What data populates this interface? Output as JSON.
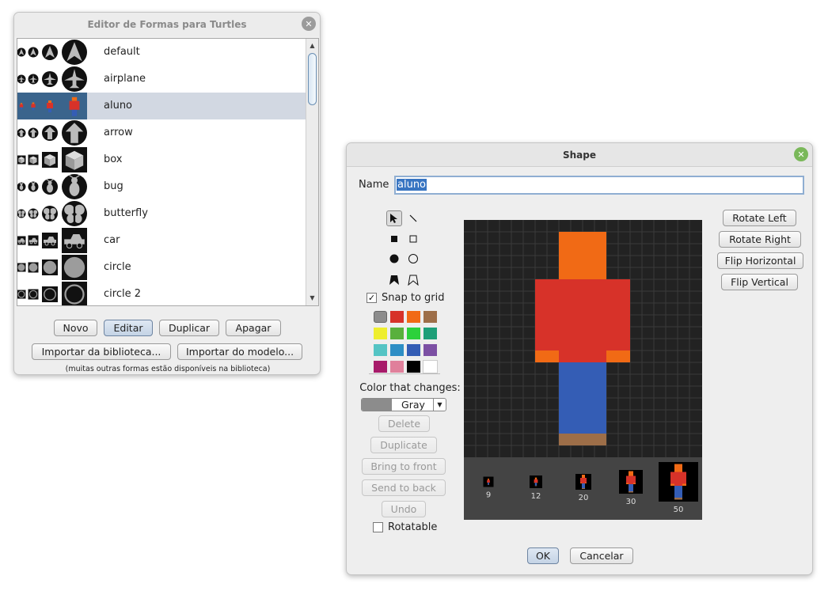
{
  "shapes_editor": {
    "title": "Editor de Formas para Turtles",
    "close_icon": "x-icon",
    "shapes": [
      {
        "name": "default",
        "icon": "arrowhead-icon"
      },
      {
        "name": "airplane",
        "icon": "airplane-icon"
      },
      {
        "name": "aluno",
        "icon": "person-icon",
        "selected": true
      },
      {
        "name": "arrow",
        "icon": "up-arrow-icon"
      },
      {
        "name": "box",
        "icon": "cube-icon"
      },
      {
        "name": "bug",
        "icon": "bug-icon"
      },
      {
        "name": "butterfly",
        "icon": "butterfly-icon"
      },
      {
        "name": "car",
        "icon": "car-icon"
      },
      {
        "name": "circle",
        "icon": "filled-circle-icon"
      },
      {
        "name": "circle 2",
        "icon": "ring-icon"
      }
    ],
    "buttons": {
      "new": "Novo",
      "edit": "Editar",
      "duplicate": "Duplicar",
      "delete": "Apagar",
      "import_library": "Importar da biblioteca...",
      "import_model": "Importar do modelo..."
    },
    "footnote": "(muitas outras formas estão disponíveis na biblioteca)"
  },
  "shape_dialog": {
    "title": "Shape",
    "name_label": "Name",
    "name_value": "aluno",
    "snap_to_grid": "Snap to grid",
    "snap_checked": true,
    "color_changes_label": "Color that changes:",
    "color_changes_value": "Gray",
    "buttons": {
      "delete": "Delete",
      "duplicate": "Duplicate",
      "bring_to_front": "Bring to front",
      "send_to_back": "Send to back",
      "undo": "Undo",
      "rotate_left": "Rotate Left",
      "rotate_right": "Rotate Right",
      "flip_horizontal": "Flip Horizontal",
      "flip_vertical": "Flip Vertical",
      "ok": "OK",
      "cancel": "Cancelar"
    },
    "rotatable": "Rotatable",
    "rotatable_checked": false,
    "palette": [
      "#8c8c8c",
      "#d73229",
      "#f16a15",
      "#9d6e48",
      "#eeee2e",
      "#59b03c",
      "#2cd13b",
      "#1d9f78",
      "#54c4c4",
      "#2d8ec5",
      "#345db5",
      "#7c50a4",
      "#a71b6a",
      "#e0809b",
      "#000000",
      "#ffffff"
    ],
    "tools": [
      "pointer-icon",
      "line-icon",
      "filled-rectangle-icon",
      "rectangle-icon",
      "filled-circle-icon",
      "circle-icon",
      "filled-polygon-icon",
      "polygon-icon"
    ],
    "preview_sizes": [
      "9",
      "12",
      "20",
      "30",
      "50"
    ],
    "colors": {
      "head": "#f16a15",
      "body": "#d73229",
      "hands": "#f16a15",
      "legs": "#345db5",
      "feet": "#9d6e48",
      "grid_bg": "#222222",
      "grid_line": "#3a3a3a",
      "preview_bg": "#444444",
      "accent_close": "#7ab85a"
    }
  }
}
